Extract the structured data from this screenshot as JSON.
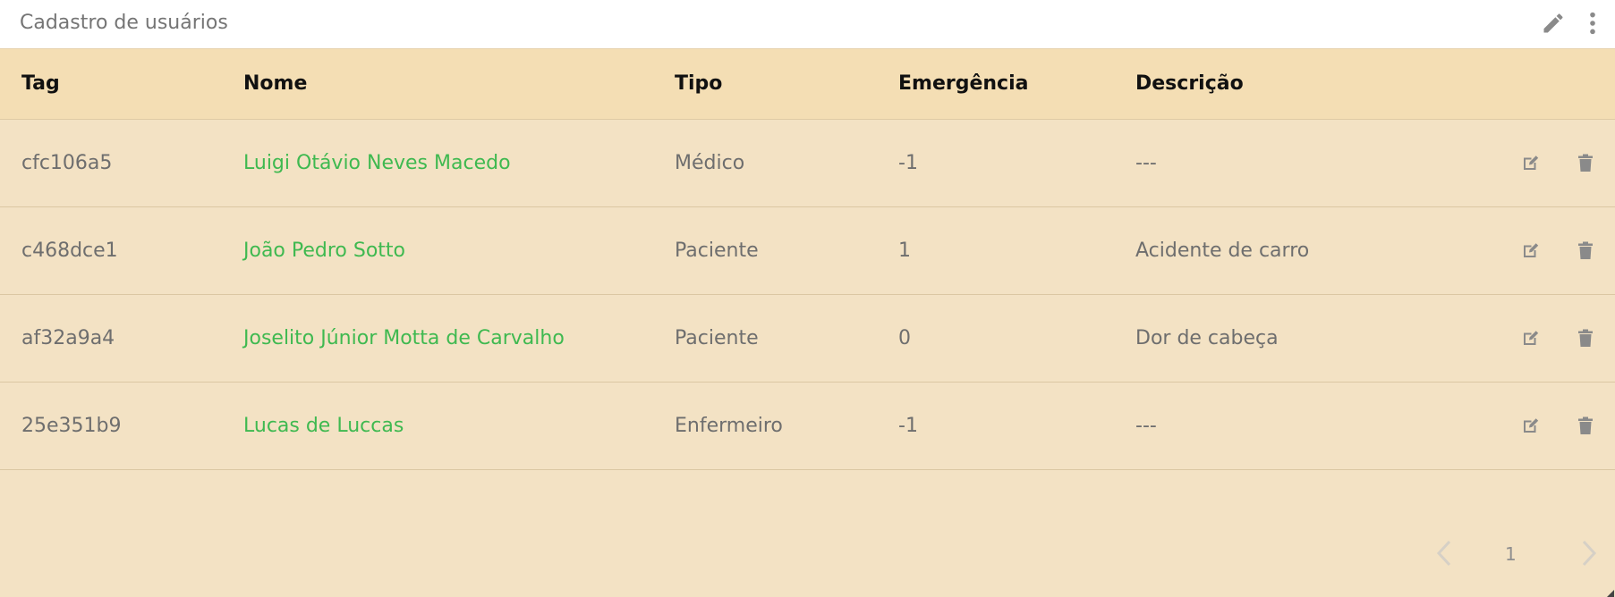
{
  "header": {
    "title": "Cadastro de usuários",
    "edit_icon": "pencil-icon",
    "menu_icon": "kebab-menu-icon"
  },
  "table": {
    "columns": [
      "Tag",
      "Nome",
      "Tipo",
      "Emergência",
      "Descrição"
    ],
    "rows": [
      {
        "tag": "cfc106a5",
        "nome": "Luigi Otávio Neves Macedo",
        "tipo": "Médico",
        "emergencia": "-1",
        "descricao": "---"
      },
      {
        "tag": "c468dce1",
        "nome": "João Pedro Sotto",
        "tipo": "Paciente",
        "emergencia": "1",
        "descricao": "Acidente de carro"
      },
      {
        "tag": "af32a9a4",
        "nome": "Joselito Júnior Motta de Carvalho",
        "tipo": "Paciente",
        "emergencia": "0",
        "descricao": "Dor de cabeça"
      },
      {
        "tag": "25e351b9",
        "nome": "Lucas de Luccas",
        "tipo": "Enfermeiro",
        "emergencia": "-1",
        "descricao": "---"
      }
    ],
    "row_action_icons": [
      "edit-icon",
      "trash-icon"
    ]
  },
  "pagination": {
    "current_page": "1",
    "prev_icon": "chevron-left-icon",
    "next_icon": "chevron-right-icon"
  },
  "colors": {
    "background": "#f3e2c4",
    "header_row": "#f4deb4",
    "name_link": "#3fb950",
    "text": "#6e6e6e",
    "icon": "#8a8a8a"
  }
}
